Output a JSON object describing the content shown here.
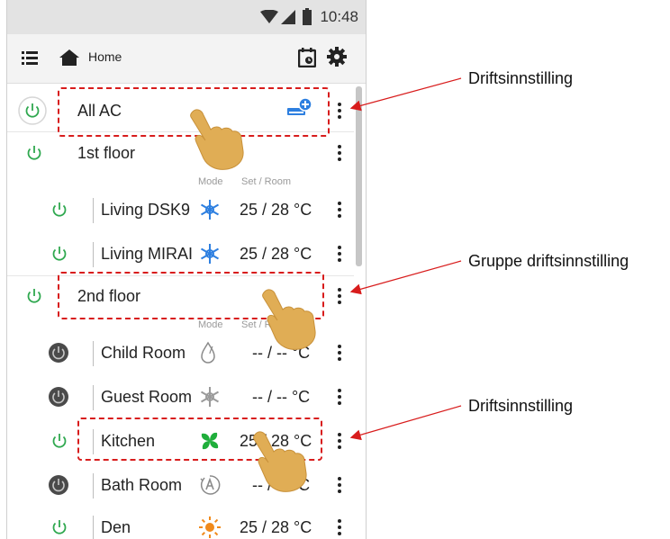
{
  "status_bar": {
    "time": "10:48"
  },
  "toolbar": {
    "title": "Home"
  },
  "all_ac": {
    "label": "All AC"
  },
  "column_headers": {
    "mode": "Mode",
    "set_room": "Set / Room"
  },
  "groups": [
    {
      "name": "1st floor"
    },
    {
      "name": "2nd floor"
    }
  ],
  "units": [
    {
      "name": "Living DSK9",
      "mode_icon": "snowflake-icon",
      "temp": "25 / 28 °C",
      "power": "on"
    },
    {
      "name": "Living MIRAI",
      "mode_icon": "snowflake-icon",
      "temp": "25 / 28 °C",
      "power": "on"
    },
    {
      "name": "Child Room",
      "mode_icon": "droplet-icon",
      "temp": "-- / --  °C",
      "power": "off"
    },
    {
      "name": "Guest Room",
      "mode_icon": "snowflake-icon",
      "temp": "-- / --  °C",
      "power": "off"
    },
    {
      "name": "Kitchen",
      "mode_icon": "fan-icon",
      "temp": "25 / 28 °C",
      "power": "on"
    },
    {
      "name": "Bath Room",
      "mode_icon": "auto-icon",
      "temp": "-- / --  °C",
      "power": "off"
    },
    {
      "name": "Den",
      "mode_icon": "sun-icon",
      "temp": "25 / 28 °C",
      "power": "on"
    }
  ],
  "annotations": [
    {
      "label": "Driftsinnstilling"
    },
    {
      "label": "Gruppe driftsinnstilling"
    },
    {
      "label": "Driftsinnstilling"
    }
  ],
  "colors": {
    "power_on": "#2fa84f",
    "power_off": "#4a4a4a",
    "cool_blue": "#2d7fe0",
    "fan_green": "#1fae3b",
    "heat_orange": "#f08a1c",
    "annotation_red": "#d81c1c"
  }
}
